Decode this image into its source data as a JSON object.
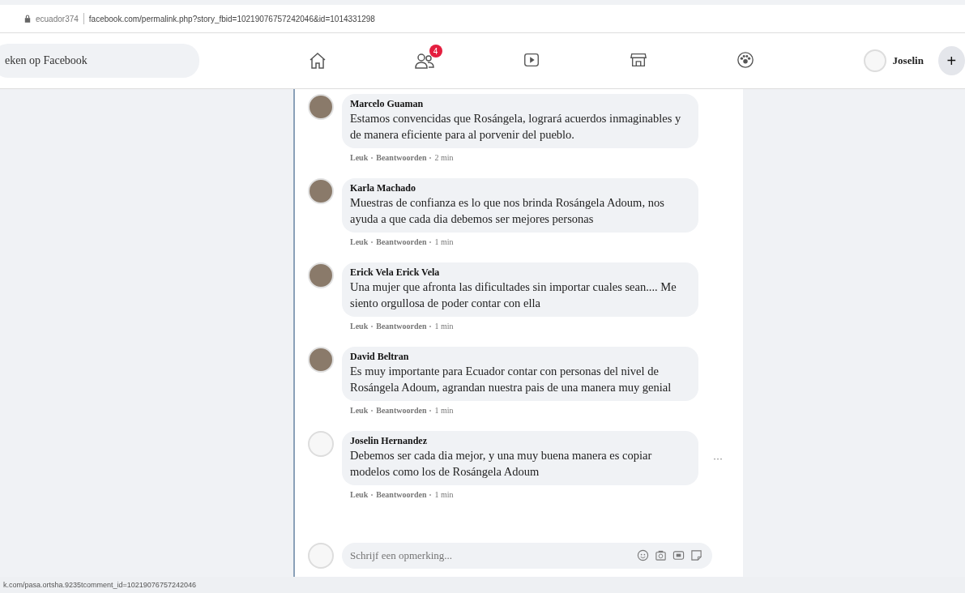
{
  "address_bar": {
    "site": "ecuador374",
    "url": "facebook.com/permalink.php?story_fbid=10219076757242046&id=1014331298"
  },
  "nav": {
    "search": {
      "placeholder": "eken op Facebook"
    },
    "friends_badge": "4",
    "user": "Joselin",
    "plus": "+"
  },
  "comments": [
    {
      "author": "Marcelo Guaman",
      "text": "Estamos convencidas que Rosángela, logrará acuerdos inmaginables y de manera eficiente para al porvenir del pueblo.",
      "like": "Leuk",
      "reply": "Beantwoorden",
      "time": "2 min",
      "kind": "photo"
    },
    {
      "author": "Karla Machado",
      "text": "Muestras de confianza es lo que nos brinda Rosángela Adoum, nos ayuda a que cada dia debemos ser mejores personas",
      "like": "Leuk",
      "reply": "Beantwoorden",
      "time": "1 min",
      "kind": "photo"
    },
    {
      "author": "Erick Vela Erick Vela",
      "text": "Una mujer que afronta las dificultades sin importar cuales sean.... Me siento orgullosa de poder contar con ella",
      "like": "Leuk",
      "reply": "Beantwoorden",
      "time": "1 min",
      "kind": "photo"
    },
    {
      "author": "David Beltran",
      "text": "Es muy importante para Ecuador contar con personas del nivel de Rosángela Adoum, agrandan nuestra pais de una manera muy genial",
      "like": "Leuk",
      "reply": "Beantwoorden",
      "time": "1 min",
      "kind": "photo"
    },
    {
      "author": "Joselin Hernandez",
      "text": "Debemos ser cada dia mejor, y una muy buena manera es copiar modelos como los de Rosángela Adoum",
      "like": "Leuk",
      "reply": "Beantwoorden",
      "time": "1 min",
      "kind": "default",
      "more": "···"
    }
  ],
  "composer": {
    "placeholder": "Schrijf een opmerking..."
  },
  "status_bar": "k.com/pasa.ortsha.9235tcomment_id=10219076757242046"
}
